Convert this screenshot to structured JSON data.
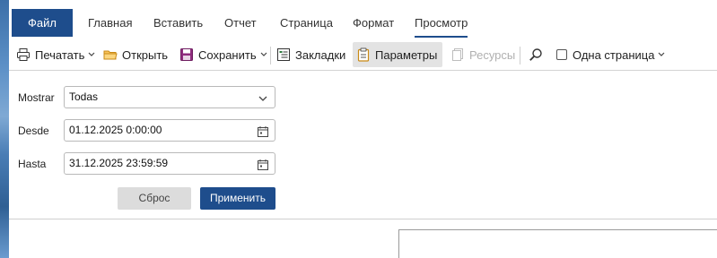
{
  "menu": {
    "tabs": [
      {
        "label": "Файл"
      },
      {
        "label": "Главная"
      },
      {
        "label": "Вставить"
      },
      {
        "label": "Отчет"
      },
      {
        "label": "Страница"
      },
      {
        "label": "Формат"
      },
      {
        "label": "Просмотр"
      }
    ],
    "active_tab": "Просмотр"
  },
  "toolbar": {
    "print_label": "Печатать",
    "open_label": "Открыть",
    "save_label": "Сохранить",
    "bookmarks_label": "Закладки",
    "parameters_label": "Параметры",
    "resources_label": "Ресурсы",
    "one_page_label": "Одна страница",
    "one_page_checked": false
  },
  "params": {
    "show_label": "Mostrar",
    "show_value": "Todas",
    "from_label": "Desde",
    "from_value": "01.12.2025 0:00:00",
    "to_label": "Hasta",
    "to_value": "31.12.2025 23:59:59",
    "reset_label": "Сброс",
    "apply_label": "Применить"
  },
  "colors": {
    "accent": "#1e4d8c",
    "reset_bg": "#dcdcdc",
    "pressed_bg": "#e3e3e3"
  }
}
